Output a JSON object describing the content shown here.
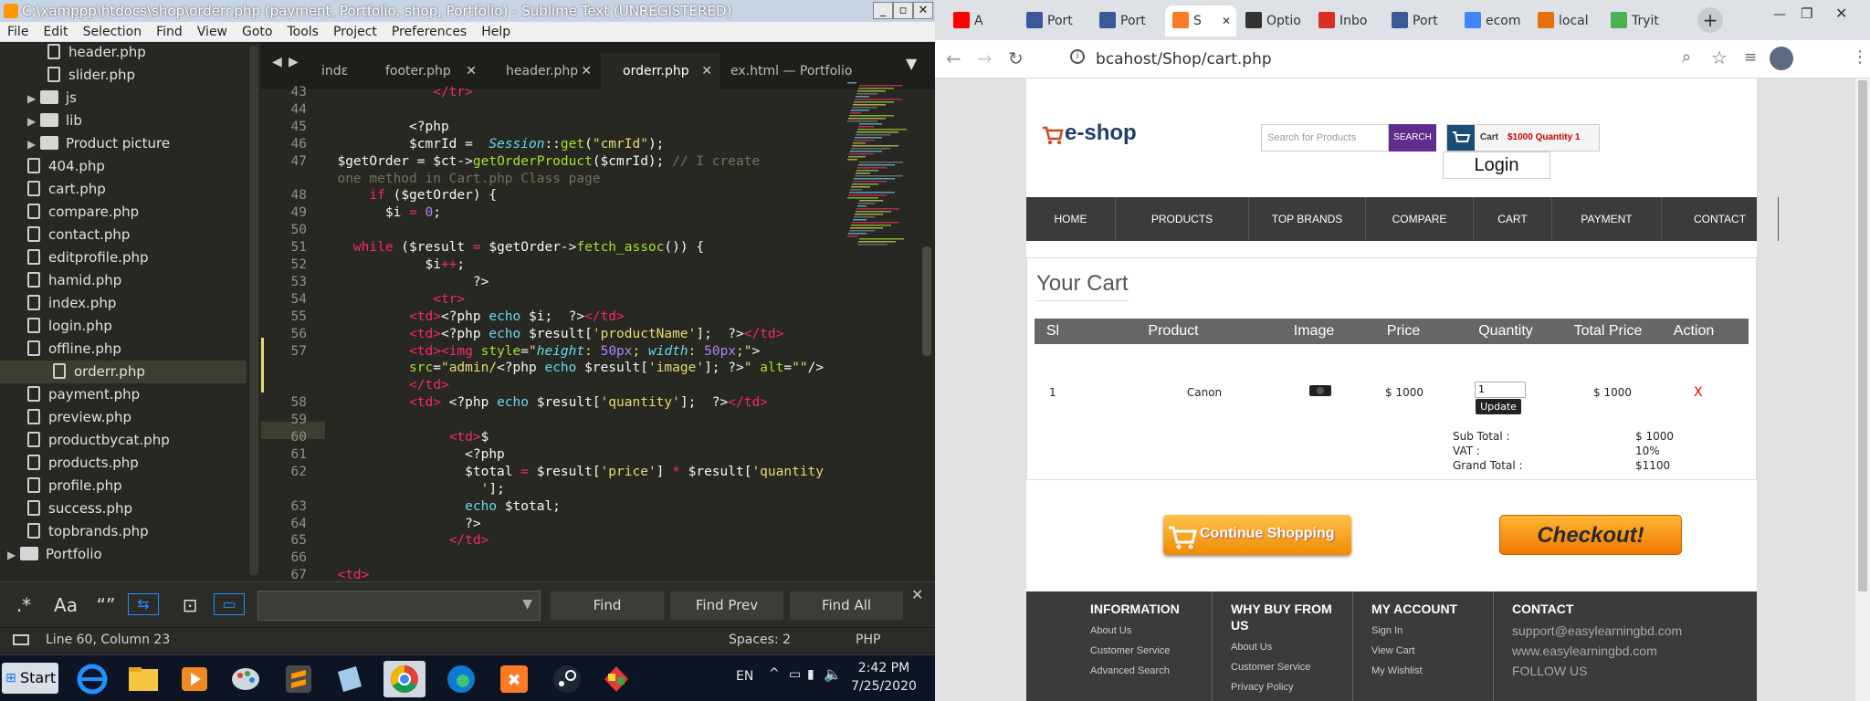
{
  "editor": {
    "title": "C:\\xamppp\\htdocs\\shop\\orderr.php (payment, Portfolio, shop, Portfolio) - Sublime Text (UNREGISTERED)",
    "menu": [
      "File",
      "Edit",
      "Selection",
      "Find",
      "View",
      "Goto",
      "Tools",
      "Project",
      "Preferences",
      "Help"
    ],
    "sidebar": [
      {
        "label": "header.php",
        "type": "file",
        "indent": 3
      },
      {
        "label": "slider.php",
        "type": "file",
        "indent": 3
      },
      {
        "label": "js",
        "type": "folder",
        "indent": 2
      },
      {
        "label": "lib",
        "type": "folder",
        "indent": 2
      },
      {
        "label": "Product picture",
        "type": "folder",
        "indent": 2
      },
      {
        "label": "404.php",
        "type": "file",
        "indent": 2
      },
      {
        "label": "cart.php",
        "type": "file",
        "indent": 2
      },
      {
        "label": "compare.php",
        "type": "file",
        "indent": 2
      },
      {
        "label": "contact.php",
        "type": "file",
        "indent": 2
      },
      {
        "label": "editprofile.php",
        "type": "file",
        "indent": 2
      },
      {
        "label": "hamid.php",
        "type": "file",
        "indent": 2
      },
      {
        "label": "index.php",
        "type": "file",
        "indent": 2
      },
      {
        "label": "login.php",
        "type": "file",
        "indent": 2
      },
      {
        "label": "offline.php",
        "type": "file",
        "indent": 2
      },
      {
        "label": "orderr.php",
        "type": "file",
        "indent": 2,
        "selected": true
      },
      {
        "label": "payment.php",
        "type": "file",
        "indent": 2
      },
      {
        "label": "preview.php",
        "type": "file",
        "indent": 2
      },
      {
        "label": "productbycat.php",
        "type": "file",
        "indent": 2
      },
      {
        "label": "products.php",
        "type": "file",
        "indent": 2
      },
      {
        "label": "profile.php",
        "type": "file",
        "indent": 2
      },
      {
        "label": "success.php",
        "type": "file",
        "indent": 2
      },
      {
        "label": "topbrands.php",
        "type": "file",
        "indent": 2
      },
      {
        "label": "Portfolio",
        "type": "folder",
        "indent": 1
      }
    ],
    "tabs": [
      {
        "label": "indε"
      },
      {
        "label": "footer.php"
      },
      {
        "label": "header.php"
      },
      {
        "label": "orderr.php",
        "active": true
      },
      {
        "label": "ex.html — Portfolio"
      }
    ],
    "code": [
      {
        "n": "43",
        "html": "              <span style=\"color:#f92672\">&lt;/tr&gt;</span>"
      },
      {
        "n": "44",
        "html": ""
      },
      {
        "n": "45",
        "html": "           &lt;?php"
      },
      {
        "n": "46",
        "html": "           $cmrId =  <span style=\"color:#66d9ef;font-style:italic\">Session</span>::<span style=\"color:#a6e22e\">get</span>(<span style=\"color:#e6db74\">\"cmrId\"</span>);"
      },
      {
        "n": "47",
        "html": "  $getOrder = $ct-&gt;<span style=\"color:#a6e22e\">getOrderProduct</span>($cmrId); <span style=\"color:#75715e\">// I create</span>"
      },
      {
        "n": "",
        "html": "  <span style=\"color:#75715e\">one method in Cart.php Class page</span>"
      },
      {
        "n": "48",
        "html": "      <span style=\"color:#f92672\">if</span> ($getOrder) {"
      },
      {
        "n": "49",
        "html": "        $i <span style=\"color:#f92672\">=</span> <span style=\"color:#ae81ff\">0</span>;"
      },
      {
        "n": "50",
        "html": ""
      },
      {
        "n": "51",
        "html": "    <span style=\"color:#f92672\">while</span> ($result <span style=\"color:#f92672\">=</span> $getOrder-&gt;<span style=\"color:#a6e22e\">fetch_assoc</span>()) {"
      },
      {
        "n": "52",
        "html": "             $i<span style=\"color:#f92672\">++</span>;"
      },
      {
        "n": "53",
        "html": "                   ?&gt;"
      },
      {
        "n": "54",
        "html": "              <span style=\"color:#f92672\">&lt;tr&gt;</span>"
      },
      {
        "n": "55",
        "html": "           <span style=\"color:#f92672\">&lt;td&gt;</span>&lt;?php <span style=\"color:#66d9ef\">echo</span> $i;  ?&gt;<span style=\"color:#f92672\">&lt;/td&gt;</span>"
      },
      {
        "n": "56",
        "html": "           <span style=\"color:#f92672\">&lt;td&gt;</span>&lt;?php <span style=\"color:#66d9ef\">echo</span> $result[<span style=\"color:#e6db74\">'productName'</span>];  ?&gt;<span style=\"color:#f92672\">&lt;/td&gt;</span>"
      },
      {
        "n": "57",
        "html": "           <span style=\"color:#f92672\">&lt;td&gt;&lt;img</span> <span style=\"color:#a6e22e\">style</span>=<span style=\"color:#e6db74\">\"<span style=\"color:#66d9ef;font-style:italic\">height</span>: <span style=\"color:#ae81ff\">50px</span>; <span style=\"color:#66d9ef;font-style:italic\">width</span>: <span style=\"color:#ae81ff\">50px</span>;\"</span>&gt;"
      },
      {
        "n": "",
        "html": "           <span style=\"color:#a6e22e\">src</span>=<span style=\"color:#e6db74\">\"admin/</span>&lt;?php <span style=\"color:#66d9ef\">echo</span> $result[<span style=\"color:#e6db74\">'image'</span>]; ?&gt;<span style=\"color:#e6db74\">\"</span> <span style=\"color:#a6e22e\">alt</span>=<span style=\"color:#e6db74\">\"\"</span>/&gt;"
      },
      {
        "n": "",
        "html": "           <span style=\"color:#f92672\">&lt;/td&gt;</span>"
      },
      {
        "n": "58",
        "html": "           <span style=\"color:#f92672\">&lt;td&gt;</span> &lt;?php <span style=\"color:#66d9ef\">echo</span> $result[<span style=\"color:#e6db74\">'quantity'</span>];  ?&gt;<span style=\"color:#f92672\">&lt;/td&gt;</span>"
      },
      {
        "n": "59",
        "html": ""
      },
      {
        "n": "60",
        "html": "                <span style=\"color:#f92672\">&lt;td&gt;</span>$"
      },
      {
        "n": "61",
        "html": "                  &lt;?php"
      },
      {
        "n": "62",
        "html": "                  $total <span style=\"color:#f92672\">=</span> $result[<span style=\"color:#e6db74\">'price'</span>] <span style=\"color:#f92672\">*</span> $result[<span style=\"color:#e6db74\">'quantity</span>"
      },
      {
        "n": "",
        "html": "                    <span style=\"color:#e6db74\">'</span>];"
      },
      {
        "n": "63",
        "html": "                  <span style=\"color:#66d9ef\">echo</span> $total;"
      },
      {
        "n": "64",
        "html": "                  ?&gt;"
      },
      {
        "n": "65",
        "html": "                <span style=\"color:#f92672\">&lt;/td&gt;</span>"
      },
      {
        "n": "66",
        "html": ""
      },
      {
        "n": "67",
        "html": "  <span style=\"color:#f92672\">&lt;td&gt;</span>"
      }
    ],
    "find": {
      "options": [
        ".*",
        "Aa",
        "“”",
        "⇆",
        "⊡",
        "▭"
      ],
      "find": "Find",
      "prev": "Find Prev",
      "all": "Find All"
    },
    "status": {
      "position": "Line 60, Column 23",
      "spaces": "Spaces: 2",
      "syntax": "PHP"
    }
  },
  "taskbar": {
    "start": "Start",
    "lang": "EN",
    "time": "2:42 PM",
    "date": "7/25/2020"
  },
  "browser": {
    "tabs": [
      {
        "label": "A",
        "color": "#ff0000"
      },
      {
        "label": "Port",
        "color": "#3b5998"
      },
      {
        "label": "Port",
        "color": "#3b5998"
      },
      {
        "label": "S",
        "color": "#fb7a24",
        "active": true
      },
      {
        "label": "Optio",
        "color": "#333"
      },
      {
        "label": "Inbo",
        "color": "#d93025"
      },
      {
        "label": "Port",
        "color": "#3b5998"
      },
      {
        "label": "ecom",
        "color": "#4285f4"
      },
      {
        "label": "local",
        "color": "#e8710a"
      },
      {
        "label": "Tryit",
        "color": "#4caf50"
      }
    ],
    "url": "bcahost/Shop/cart.php",
    "shop": {
      "logo": "e-shop",
      "search_placeholder": "Search for Products",
      "search_btn": "SEARCH",
      "cart_label": "Cart",
      "cart_info": "$1000 Quantity 1",
      "login": "Login",
      "nav": [
        "Home",
        "Products",
        "Top Brands",
        "Compare",
        "Cart",
        "Payment",
        "Contact"
      ],
      "heading": "Your Cart",
      "cols": [
        "Sl",
        "Product Name",
        "Image",
        "Price",
        "Quantity",
        "Total Price",
        "Action"
      ],
      "row": {
        "sl": "1",
        "name": "Canon",
        "price": "$ 1000",
        "qty": "1",
        "update": "Update",
        "total": "$ 1000",
        "action": "X"
      },
      "sub_total_label": "Sub Total :",
      "sub_total": "$ 1000",
      "vat_label": "VAT :",
      "vat": "10%",
      "grand_label": "Grand Total :",
      "grand": "$1100",
      "continue": "Continue Shopping",
      "checkout": "Checkout!",
      "footer": [
        {
          "h": "Information",
          "links": [
            "About Us",
            "Customer Service",
            "Advanced Search"
          ]
        },
        {
          "h": "Why buy from us",
          "links": [
            "About Us",
            "Customer Service",
            "Privacy Policy"
          ]
        },
        {
          "h": "My account",
          "links": [
            "Sign In",
            "View Cart",
            "My Wishlist"
          ]
        },
        {
          "h": "Contact",
          "links": [
            "support@easylearningbd.com",
            "www.easylearningbd.com",
            "FOLLOW US"
          ]
        }
      ]
    }
  }
}
